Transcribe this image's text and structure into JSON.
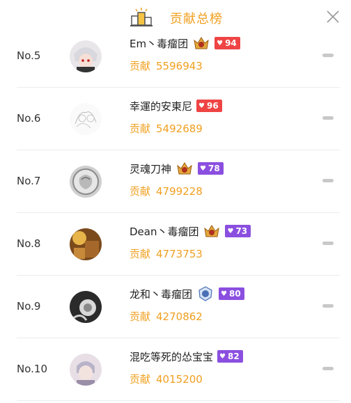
{
  "header": {
    "title": "贡献总榜",
    "podium_icon": "podium-icon",
    "close_icon": "close-icon"
  },
  "colors": {
    "accent": "#f0a020",
    "badge_red": "#ef4444",
    "badge_purple": "#8b4fe0"
  },
  "rows": [
    {
      "rank": "No.5",
      "name": "Em丶毒瘤团",
      "contrib_label": "贡献",
      "contrib_value": "5596943",
      "level": "94",
      "badge_color": "red",
      "noble": true
    },
    {
      "rank": "No.6",
      "name": "幸運的安東尼",
      "contrib_label": "贡献",
      "contrib_value": "5492689",
      "level": "96",
      "badge_color": "red",
      "noble": false
    },
    {
      "rank": "No.7",
      "name": "灵魂刀神",
      "contrib_label": "贡献",
      "contrib_value": "4799228",
      "level": "78",
      "badge_color": "purple",
      "noble": true
    },
    {
      "rank": "No.8",
      "name": "Dean丶毒瘤团",
      "contrib_label": "贡献",
      "contrib_value": "4773753",
      "level": "73",
      "badge_color": "purple",
      "noble": true
    },
    {
      "rank": "No.9",
      "name": "龙和丶毒瘤团",
      "contrib_label": "贡献",
      "contrib_value": "4270862",
      "level": "80",
      "badge_color": "purple",
      "noble": true
    },
    {
      "rank": "No.10",
      "name": "混吃等死的怂宝宝",
      "contrib_label": "贡献",
      "contrib_value": "4015200",
      "level": "82",
      "badge_color": "purple",
      "noble": false
    }
  ]
}
